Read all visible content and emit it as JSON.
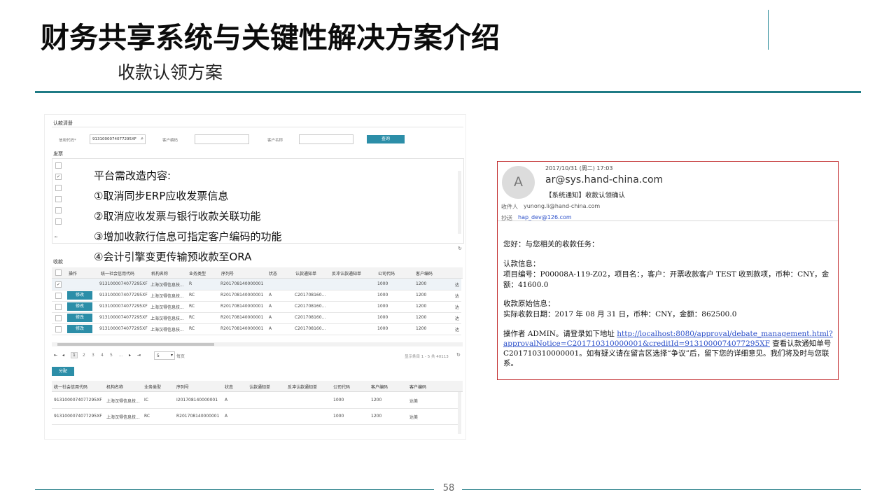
{
  "slide": {
    "title": "财务共享系统与关键性解决方案介绍",
    "subtitle": "收款认领方案",
    "page_number": "58"
  },
  "screenshot": {
    "section_title": "认款清册",
    "filter": {
      "credit_code_label": "信用代码*",
      "credit_code_value": "913100007407729­5XF",
      "customer_code_label": "客户编码",
      "customer_name_label": "客户名称",
      "query_button": "查询"
    },
    "invoice_section": "发票",
    "receipt_section": "收款",
    "notes": [
      "平台需改造内容:",
      "①取消同步ERP应收发票信息",
      "②取消应收发票与银行收款关联功能",
      "③增加收款行信息可指定客户编码的功能",
      "④会计引擎变更传输预收款至ORA"
    ],
    "table1": {
      "headers": [
        "操作",
        "统一社会信用代码",
        "机构名称",
        "业务类型",
        "序列号",
        "状态",
        "认款通知单",
        "反冲认款通知单",
        "公司代码",
        "客户编码"
      ],
      "rows": [
        {
          "action": "",
          "code": "9131000074077295XF",
          "org": "上海汉得信息技...",
          "type": "R",
          "serial": "R201708140000001",
          "status": "",
          "notice": "",
          "reverse": "",
          "company": "1000",
          "customer": "1200",
          "extra": "达"
        },
        {
          "action": "修改",
          "code": "9131000074077295XF",
          "org": "上海汉得信息技...",
          "type": "RC",
          "serial": "R201708140000001",
          "status": "A",
          "notice": "C201708160...",
          "reverse": "",
          "company": "1000",
          "customer": "1200",
          "extra": "达"
        },
        {
          "action": "修改",
          "code": "9131000074077295XF",
          "org": "上海汉得信息技...",
          "type": "RC",
          "serial": "R201708140000001",
          "status": "A",
          "notice": "C201708160...",
          "reverse": "",
          "company": "1000",
          "customer": "1200",
          "extra": "达"
        },
        {
          "action": "修改",
          "code": "9131000074077295XF",
          "org": "上海汉得信息技...",
          "type": "RC",
          "serial": "R201708140000001",
          "status": "A",
          "notice": "C201708160...",
          "reverse": "",
          "company": "1000",
          "customer": "1200",
          "extra": "达"
        },
        {
          "action": "修改",
          "code": "9131000074077295XF",
          "org": "上海汉得信息技...",
          "type": "RC",
          "serial": "R201708140000001",
          "status": "A",
          "notice": "C201708160...",
          "reverse": "",
          "company": "1000",
          "customer": "1200",
          "extra": "达"
        }
      ]
    },
    "pager": {
      "pages": [
        "1",
        "2",
        "3",
        "4",
        "5",
        "..."
      ],
      "page_size": "5",
      "per_page_label": "每页",
      "summary": "显示条目 1 - 5 共 40113"
    },
    "allocate_button": "分配",
    "table2": {
      "headers": [
        "统一社会信用代码",
        "机构名称",
        "业务类型",
        "序列号",
        "状态",
        "认款通知单",
        "反冲认款通知单",
        "公司代码",
        "客户编码",
        "客户编码"
      ],
      "rows": [
        {
          "code": "9131000074077295XF",
          "org": "上海汉得信息技...",
          "type": "IC",
          "serial": "I201708140000001",
          "status": "A",
          "company": "1000",
          "customer": "1200",
          "name": "达美"
        },
        {
          "code": "9131000074077295XF",
          "org": "上海汉得信息技...",
          "type": "RC",
          "serial": "R201708140000001",
          "status": "A",
          "company": "1000",
          "customer": "1200",
          "name": "达美"
        }
      ]
    }
  },
  "email": {
    "avatar_letter": "A",
    "datetime": "2017/10/31 (周二) 17:03",
    "from": "ar@sys.hand-china.com",
    "subject": "【系统通知】收款认领确认",
    "to_label": "收件人",
    "to_value": "yunong.li@hand-china.com",
    "cc_label": "抄送",
    "cc_value": "hap_dev@126.com",
    "greeting": "您好：与您相关的收款任务：",
    "info_title": "认款信息：",
    "info_line1": "项目编号：P00008A-119-Z02，项目名：，客户：开票收款客户 TEST 收到款项，币种：CNY，金",
    "info_line2": "额：41600.0",
    "orig_title": "收款原始信息：",
    "orig_line": "实际收款日期：2017 年 08 月 31 日，币种：CNY，金额：862500.0",
    "op_prefix": "操作者 ADMIN。请登录如下地址 ",
    "link1": "http://localhost:8080/approval/debate_management.html?",
    "link2": "approvalNotice=C201710310000001&creditId=913100007407729­5XF",
    "link_suffix": " 查看认款通知单号",
    "op_line3": "C201710310000001。如有疑义请在留言区选择“争议”后，留下您的详细意见。我们将及时与您联",
    "op_line4": "系。"
  }
}
